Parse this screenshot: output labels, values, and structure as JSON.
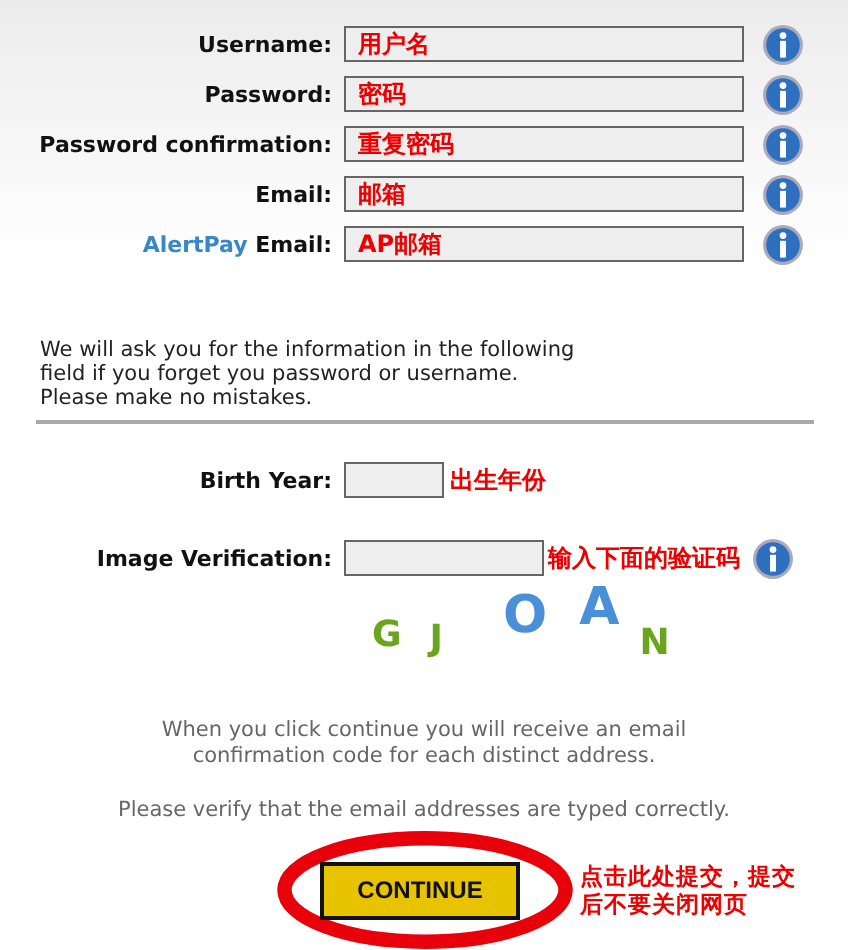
{
  "account_fields": [
    {
      "label": "Username:",
      "value": "用户名"
    },
    {
      "label": "Password:",
      "value": "密码"
    },
    {
      "label": "Password confirmation:",
      "value": "重复密码"
    },
    {
      "label": "Email:",
      "value": "邮箱"
    },
    {
      "label_brand": "AlertPay",
      "label": "Email:",
      "value": "AP邮箱"
    }
  ],
  "notice": [
    "We will ask you for the information in the following",
    "field if you forget you password or username.",
    "Please make no mistakes."
  ],
  "birth_year": {
    "label": "Birth Year:",
    "note": "出生年份"
  },
  "image_verification": {
    "label": "Image Verification:",
    "note": "输入下面的验证码"
  },
  "captcha": [
    {
      "char": "G",
      "color": "#6aa51e"
    },
    {
      "char": "J",
      "color": "#6aa51e"
    },
    {
      "char": "O",
      "color": "#4a90d9"
    },
    {
      "char": "A",
      "color": "#4a90d9"
    },
    {
      "char": "N",
      "color": "#6aa51e"
    }
  ],
  "info_lines": [
    "When you click continue you will receive an email confirmation code for each distinct address.",
    "Please verify that the email addresses are typed correctly."
  ],
  "continue_button": "CONTINUE",
  "submit_note": "点击此处提交，提交后不要关闭网页"
}
